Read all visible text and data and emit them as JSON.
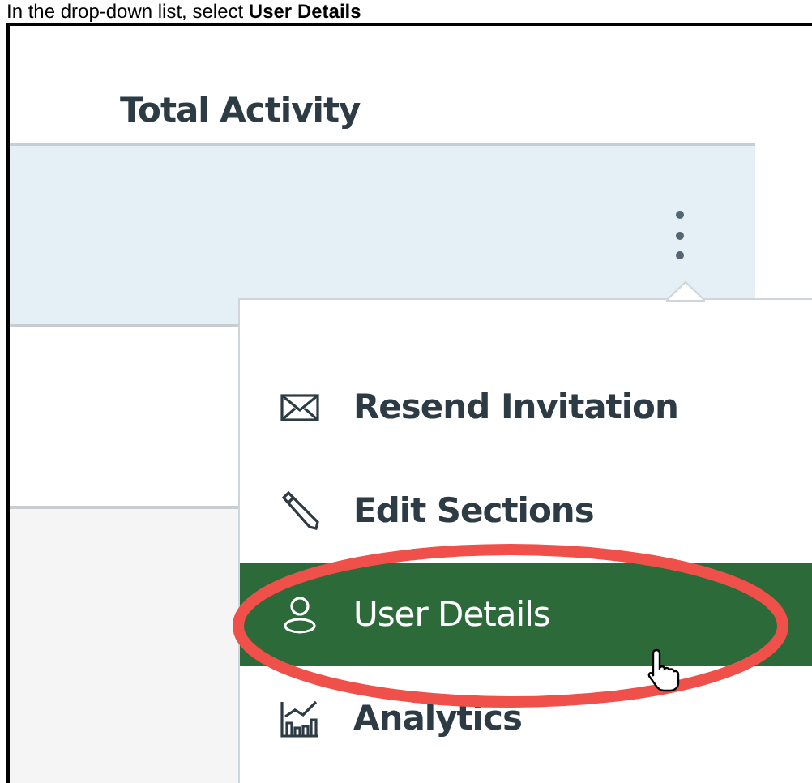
{
  "caption": "In the drop-down list, select **User Details**",
  "table": {
    "column_header": "Total Activity",
    "rows": [
      {
        "selected": true
      },
      {
        "selected": false
      },
      {
        "selected": false
      }
    ]
  },
  "menu": {
    "items": [
      {
        "kind": "envelope",
        "label": "Resend Invitation",
        "selected": false
      },
      {
        "kind": "pencil",
        "label": "Edit Sections",
        "selected": false
      },
      {
        "kind": "user",
        "label": "User Details",
        "selected": true
      },
      {
        "kind": "chart",
        "label": "Analytics",
        "selected": false
      }
    ]
  }
}
